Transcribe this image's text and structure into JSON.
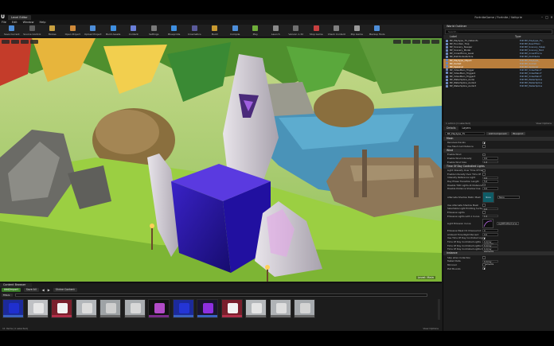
{
  "app": {
    "tab_label": "Level Editor",
    "window_path": "FortniteGame / Fortnite / Valkyrie"
  },
  "menu": [
    "File",
    "Edit",
    "Window",
    "Help"
  ],
  "toolbar": [
    {
      "label": "Save Current",
      "color": "#4d8ed9"
    },
    {
      "label": "Source Control",
      "color": "#5d5d5d"
    },
    {
      "label": "Modes",
      "color": "#c8a040"
    },
    {
      "label": "Open Project",
      "color": "#d08a3a"
    },
    {
      "label": "Upload Project",
      "color": "#4d8ed9"
    },
    {
      "label": "Build Assets",
      "color": "#3e8fe0"
    },
    {
      "label": "Content",
      "color": "#6a7fd8"
    },
    {
      "label": "Settings",
      "color": "#7a7a7a"
    },
    {
      "label": "Blueprints",
      "color": "#3e8fe0"
    },
    {
      "label": "Cinematics",
      "color": "#5a5a9a"
    },
    {
      "label": "Build",
      "color": "#c99a30"
    },
    {
      "label": "Compile",
      "color": "#4d8ed9"
    },
    {
      "label": "Play",
      "color": "#6fae3a"
    },
    {
      "label": "Launch",
      "color": "#8a8a8a"
    },
    {
      "label": "Version 1.32",
      "color": "#707070"
    },
    {
      "label": "Stop Game",
      "color": "#c84040"
    },
    {
      "label": "Check Content",
      "color": "#808080"
    },
    {
      "label": "Pop Game",
      "color": "#9a9a9a"
    },
    {
      "label": "Backup Tools",
      "color": "#4d8ed9"
    }
  ],
  "viewport": {
    "level_label": "Level: Main"
  },
  "outliner": {
    "title": "World Outliner",
    "search_placeholder": "Search...",
    "col_label": "Label",
    "col_type": "Type",
    "rows": [
      {
        "label": "BP_Playtype_TV_Dateinfo",
        "type": "Edit BP_Playtype_TV_",
        "selected": false
      },
      {
        "label": "BP_Fountain_Trap",
        "type": "Edit BP_ReactTrain",
        "selected": false
      },
      {
        "label": "BP_Scenery_Sleeper",
        "type": "Edit BP_Scenery_Sleep",
        "selected": false
      },
      {
        "label": "BP_Scenery_Model",
        "type": "Edit BP_Scenery_Mod",
        "selected": false
      },
      {
        "label": "BP_CrowdForce_Level",
        "type": "Edit BP_CrowdForce",
        "selected": false
      },
      {
        "label": "BP_DistributedActors",
        "type": "Edit BP_Distribute",
        "selected": false
      },
      {
        "label": "BP_Playtype_Object",
        "type": "Edit BP_Playtype_",
        "selected": true
      },
      {
        "label": "BP_Socket",
        "type": "Edit BP_Socket",
        "selected": true
      },
      {
        "label": "BP_Spawner",
        "type": "Edit BP_Spawner",
        "selected": true
      },
      {
        "label": "BP_VideoMain_Trigger",
        "type": "Edit BP_VideoMainT",
        "selected": false
      },
      {
        "label": "BP_VideoMain_Trigger2",
        "type": "Edit BP_VideoMainT",
        "selected": false
      },
      {
        "label": "BP_VideoMain_Trigger3",
        "type": "Edit BP_VideoMainT",
        "selected": false
      },
      {
        "label": "BP_WaterSpline_Audio",
        "type": "Edit BP_WaterSpline",
        "selected": false
      },
      {
        "label": "BP_WaterSpline_Audio2",
        "type": "Edit BP_WaterSpline",
        "selected": false
      },
      {
        "label": "BP_WaterSpline_Audio3",
        "type": "Edit BP_WaterSpline",
        "selected": false
      }
    ],
    "footer": "1 actors (1 selected)",
    "view_options": "View Options"
  },
  "details": {
    "tab_details": "Details",
    "tab_layers": "Layers",
    "selected_name": "BP_Playtype_TV",
    "add_btn": "Add Component",
    "bp_btn": "Blueprint",
    "categories": [
      {
        "title": "Mesh",
        "props": [
          {
            "label": "Receives Decals",
            "kind": "cb",
            "on": true
          },
          {
            "label": "Use Mesh Cell Distance",
            "kind": "cb",
            "on": false
          }
        ]
      },
      {
        "title": "Wind",
        "props": [
          {
            "label": "Enable Wind",
            "kind": "cb",
            "on": false
          },
          {
            "label": "Enable Wind Intensity",
            "kind": "num",
            "value": "0.0"
          },
          {
            "label": "Enable Wind Size",
            "kind": "num",
            "value": "1.0"
          }
        ]
      },
      {
        "title": "Time Of Day Controlled Lights",
        "props": [
          {
            "label": "Light Intensity Over Time Of Day",
            "kind": "cb",
            "on": false
          },
          {
            "label": "Enable Intensity Over Time Of",
            "kind": "cb",
            "on": false
          },
          {
            "label": "Intensity Reference Light",
            "kind": "num",
            "value": "0.0"
          },
          {
            "label": "Day Phase Transition Length",
            "kind": "num",
            "value": "5.0"
          },
          {
            "label": "Disable TOD Lights At Distance",
            "kind": "cb",
            "on": false
          },
          {
            "label": "Disable Distance Shadow Use",
            "kind": "num",
            "value": "0.0"
          }
        ]
      }
    ],
    "swatch_label": "Alternate Shadow Static Mesh",
    "swatch_text": "None",
    "dd_value": "None",
    "more_props": [
      {
        "label": "Use Alternate Shadow Mesh",
        "kind": "cb",
        "on": false
      },
      {
        "label": "Selectable Light Emitting Surfa",
        "kind": "num",
        "value": "0.0"
      },
      {
        "label": "Emissive Lights",
        "kind": "cb",
        "on": false
      },
      {
        "label": "Emissive Lights with 1 Curve",
        "kind": "num",
        "value": "1.0"
      }
    ],
    "curve_label": "Light Emission Curve",
    "curve_dd": "LightEmitterCurve",
    "tail_props": [
      {
        "label": "Emissive Mask UV Channel Int",
        "kind": "num",
        "value": "0"
      },
      {
        "label": "Ambient Time Night Percent",
        "kind": "num",
        "value": "0.0"
      },
      {
        "label": "Use Time Of Day Controlled Light",
        "kind": "cb",
        "on": true
      },
      {
        "label": "Time Of Day Controlled Lights",
        "kind": "num",
        "value": "0 Array elements"
      },
      {
        "label": "Time Of Day Controlled Lights In",
        "kind": "num",
        "value": "0 Array elements"
      },
      {
        "label": "Time Of Day Controlled Lights P",
        "kind": "num",
        "value": "0 Array elements"
      }
    ],
    "instance_title": "Instance",
    "instance_props": [
      {
        "label": "Skip when Collection",
        "kind": "cb",
        "on": false
      },
      {
        "label": "Tested Data",
        "kind": "num",
        "value": "0 Array elements"
      },
      {
        "label": "Mirrored",
        "kind": "cb",
        "on": false
      },
      {
        "label": "Plot Bounds",
        "kind": "cb",
        "on": true
      }
    ]
  },
  "content_browser": {
    "title": "Content Browser",
    "add_import": "Add/Import",
    "save_all": "Save All",
    "breadcrumb": "Shrine Content",
    "filters": "Filters",
    "footer": "11 items (1 selected)",
    "view_options": "View Options",
    "thumbs": [
      {
        "bg": "#1c2a9a",
        "fg": "#1f2fcf",
        "strip": "#3a62c0"
      },
      {
        "bg": "#bfc1c4",
        "fg": "#e6e6e6",
        "strip": "#7a7a7a"
      },
      {
        "bg": "#7a1f2c",
        "fg": "#f2f2f2",
        "strip": "#b0304a"
      },
      {
        "bg": "#b3b7bb",
        "fg": "#dcdcdc",
        "strip": "#6a6a6a"
      },
      {
        "bg": "#9fa3a6",
        "fg": "#cfcfcf",
        "strip": "#6a6a6a"
      },
      {
        "bg": "#a9adb0",
        "fg": "#d8d8d8",
        "strip": "#6a6a6a"
      },
      {
        "bg": "#121212",
        "fg": "#b14bc6",
        "strip": "#7a2d8a"
      },
      {
        "bg": "#1c2a9a",
        "fg": "#2435d6",
        "strip": "#3a62c0"
      },
      {
        "bg": "#1a1530",
        "fg": "#8d2fe0",
        "strip": "#3a62c0"
      },
      {
        "bg": "#7a1f2c",
        "fg": "#f2f2f2",
        "strip": "#b0304a"
      },
      {
        "bg": "#b5b8bb",
        "fg": "#e4e4e4",
        "strip": "#6a6a6a"
      },
      {
        "bg": "#b0b3b6",
        "fg": "#dedede",
        "strip": "#6a6a6a"
      },
      {
        "bg": "#a6aaae",
        "fg": "#d4d4d4",
        "strip": "#6a6a6a"
      }
    ]
  }
}
